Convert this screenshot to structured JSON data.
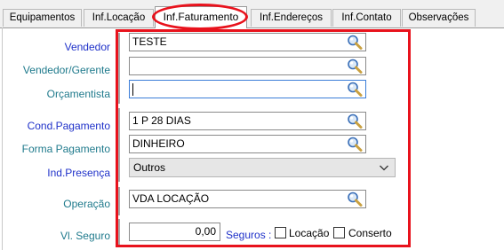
{
  "tabs": [
    {
      "label": "Equipamentos"
    },
    {
      "label": "Inf.Locação"
    },
    {
      "label": "Inf.Faturamento",
      "active": true
    },
    {
      "label": "Inf.Endereços"
    },
    {
      "label": "Inf.Contato"
    },
    {
      "label": "Observações"
    }
  ],
  "form": {
    "vendedor": {
      "label": "Vendedor",
      "value": "TESTE"
    },
    "vendedor_gerente": {
      "label": "Vendedor/Gerente",
      "value": ""
    },
    "orcamentista": {
      "label": "Orçamentista",
      "value": ""
    },
    "cond_pagamento": {
      "label": "Cond.Pagamento",
      "value": "1 P 28 DIAS"
    },
    "forma_pagamento": {
      "label": "Forma Pagamento",
      "value": "DINHEIRO"
    },
    "ind_presenca": {
      "label": "Ind.Presença",
      "value": "Outros"
    },
    "operacao": {
      "label": "Operação",
      "value": "VDA LOCAÇÃO"
    },
    "vl_seguro": {
      "label": "Vl. Seguro",
      "value": "0,00"
    }
  },
  "seguros": {
    "label": "Seguros :",
    "options": [
      {
        "label": "Locação",
        "checked": false
      },
      {
        "label": "Conserto",
        "checked": false
      }
    ]
  },
  "colors": {
    "highlight": "#e8121c",
    "label_blue": "#1f31c9",
    "label_teal": "#1f7a8c"
  },
  "icons": {
    "lookup": "magnifier-icon",
    "dropdown": "chevron-down-icon"
  }
}
